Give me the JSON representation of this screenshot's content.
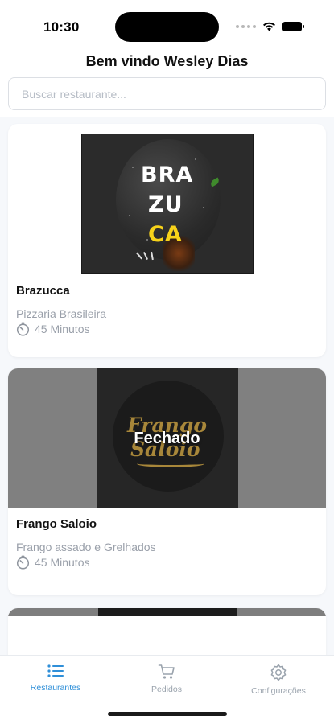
{
  "status_bar": {
    "time": "10:30"
  },
  "header": {
    "title": "Bem vindo Wesley Dias"
  },
  "search": {
    "placeholder": "Buscar restaurante..."
  },
  "restaurants": [
    {
      "name": "Brazucca",
      "category": "Pizzaria Brasileira",
      "delivery_time": "45 Minutos",
      "logo_text": [
        "BRA",
        "ZU",
        "CA"
      ],
      "status": ""
    },
    {
      "name": "Frango Saloio",
      "category": "Frango assado e Grelhados",
      "delivery_time": "45 Minutos",
      "logo_text": [
        "Frango",
        "Saloio"
      ],
      "status": "Fechado"
    }
  ],
  "tab_bar": {
    "tabs": [
      {
        "label": "Restaurantes",
        "icon": "list-icon",
        "active": true
      },
      {
        "label": "Pedidos",
        "icon": "cart-icon",
        "active": false
      },
      {
        "label": "Configurações",
        "icon": "gear-icon",
        "active": false
      }
    ]
  },
  "colors": {
    "accent": "#2f8fd8",
    "muted_text": "#9aa0aa",
    "logo_yellow": "#f7d21a",
    "logo_gold": "#a8873a"
  }
}
